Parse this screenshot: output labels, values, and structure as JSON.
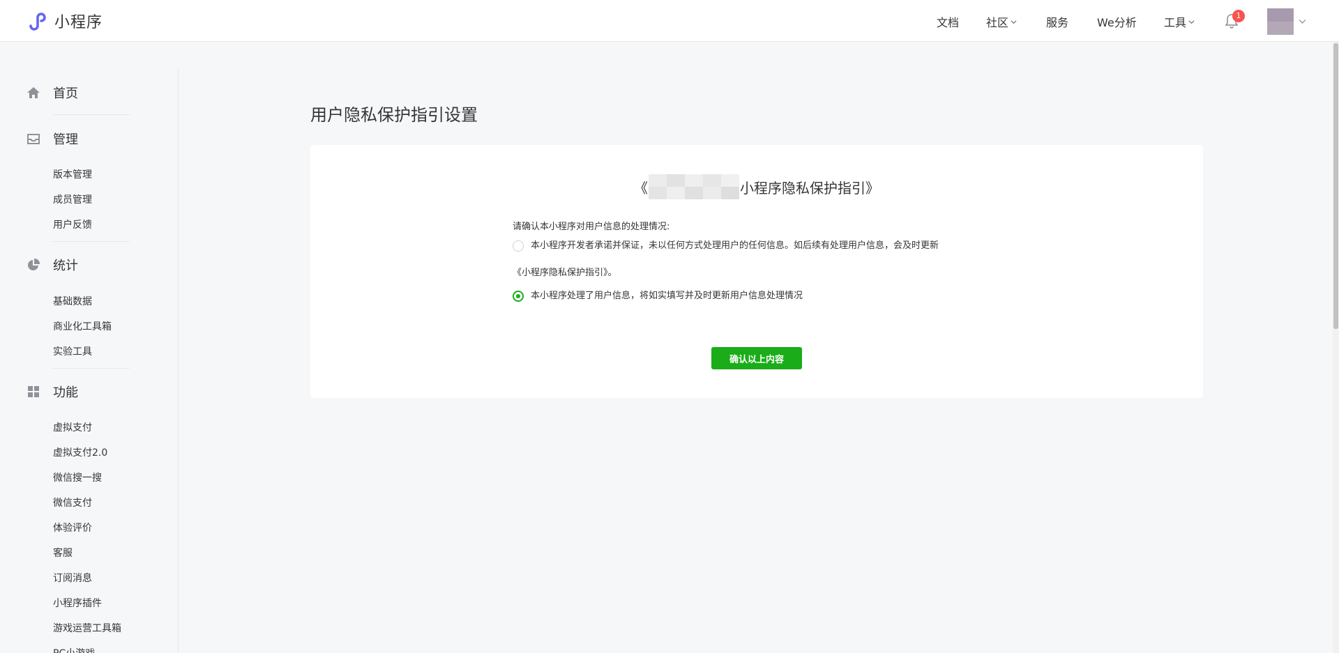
{
  "brand": {
    "name": "小程序",
    "logo_icon": "mini-program-logo-icon",
    "accent": "#6467f0"
  },
  "nav": {
    "items": [
      {
        "label": "文档",
        "dropdown": false
      },
      {
        "label": "社区",
        "dropdown": true
      },
      {
        "label": "服务",
        "dropdown": false
      },
      {
        "label": "We分析",
        "dropdown": false
      },
      {
        "label": "工具",
        "dropdown": true
      }
    ],
    "notification_count": "1"
  },
  "sidebar": {
    "sections": [
      {
        "label": "首页",
        "icon": "home-icon",
        "items": []
      },
      {
        "label": "管理",
        "icon": "inbox-icon",
        "items": [
          "版本管理",
          "成员管理",
          "用户反馈"
        ]
      },
      {
        "label": "统计",
        "icon": "pie-chart-icon",
        "items": [
          "基础数据",
          "商业化工具箱",
          "实验工具"
        ]
      },
      {
        "label": "功能",
        "icon": "grid-icon",
        "items": [
          "虚拟支付",
          "虚拟支付2.0",
          "微信搜一搜",
          "微信支付",
          "体验评价",
          "客服",
          "订阅消息",
          "小程序插件",
          "游戏运营工具箱",
          "PC小游戏"
        ]
      }
    ]
  },
  "main": {
    "page_title": "用户隐私保护指引设置",
    "panel": {
      "title_prefix": "《",
      "title_suffix": "小程序隐私保护指引》",
      "question": "请确认本小程序对用户信息的处理情况:",
      "options": [
        {
          "text": "本小程序开发者承诺并保证，未以任何方式处理用户的任何信息。如后续有处理用户信息，会及时更新",
          "text_cont": "《小程序隐私保护指引》。",
          "checked": false
        },
        {
          "text": "本小程序处理了用户信息，将如实填写并及时更新用户信息处理情况",
          "checked": true
        }
      ],
      "confirm_label": "确认以上内容"
    }
  },
  "colors": {
    "primary_green": "#1aad19",
    "badge_red": "#fa5151",
    "text": "#353535"
  }
}
